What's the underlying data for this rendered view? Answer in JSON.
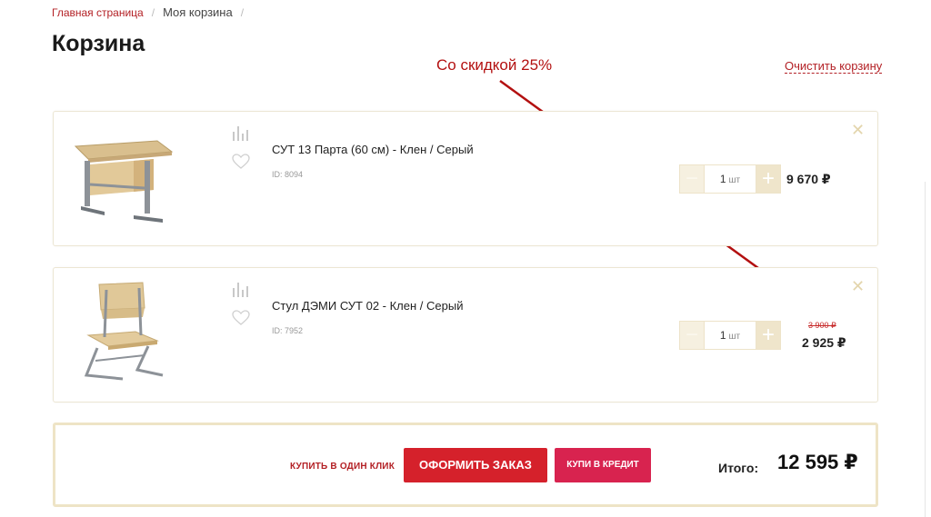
{
  "breadcrumb": {
    "home": "Главная страница",
    "separator": "/",
    "current": "Моя корзина"
  },
  "page_title": "Корзина",
  "clear_cart": "Очистить корзину",
  "annotation": {
    "text": "Со скидкой 25%",
    "color": "#b31010"
  },
  "items": [
    {
      "name": "СУТ 13 Парта (60 см) - Клен / Серый",
      "id_label": "ID: 8094",
      "quantity": "1",
      "unit": "шт",
      "minus": "−",
      "plus": "+",
      "price": "9 670 ₽",
      "remove": "✕"
    },
    {
      "name": "Стул ДЭМИ СУТ 02 - Клен / Серый",
      "id_label": "ID: 7952",
      "quantity": "1",
      "unit": "шт",
      "minus": "−",
      "plus": "+",
      "old_price": "3 900 ₽",
      "price": "2 925 ₽",
      "remove": "✕"
    }
  ],
  "checkout": {
    "one_click": "КУПИТЬ В ОДИН КЛИК",
    "order_button": "ОФОРМИТЬ ЗАКАЗ",
    "credit_button": "КУПИ В КРЕДИТ",
    "total_label": "Итого:",
    "total_value": "12 595 ₽"
  },
  "icons": {
    "compare": "bar-chart-icon",
    "favorite": "heart-icon",
    "remove": "close-icon"
  },
  "colors": {
    "brand_red": "#b32025",
    "order_button": "#d5212b",
    "credit_button": "#d8234f",
    "beige_border": "#eee4c6"
  }
}
